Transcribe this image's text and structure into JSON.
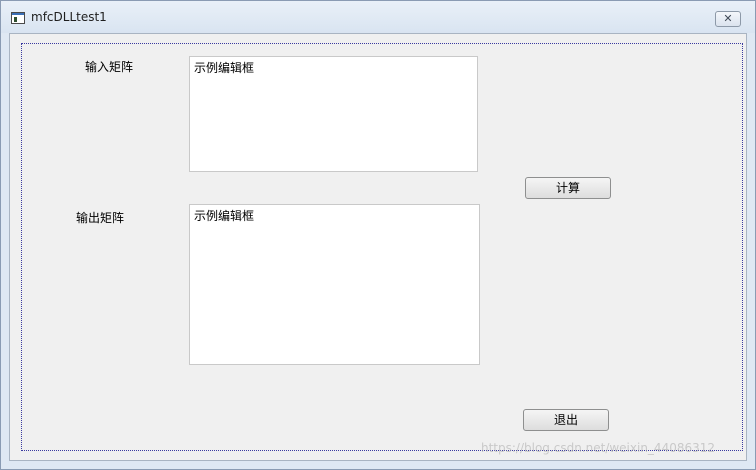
{
  "window": {
    "title": "mfcDLLtest1",
    "close_glyph": "✕"
  },
  "form": {
    "input_label": "输入矩阵",
    "input_value": "示例编辑框",
    "output_label": "输出矩阵",
    "output_value": "示例编辑框",
    "compute_button": "计算",
    "exit_button": "退出"
  },
  "watermark": "https://blog.csdn.net/weixin_44086312",
  "colors": {
    "titlebar": "#dfe8f3",
    "dialog_bg": "#f0f0f0",
    "focus_frame": "#3a3aa0"
  }
}
